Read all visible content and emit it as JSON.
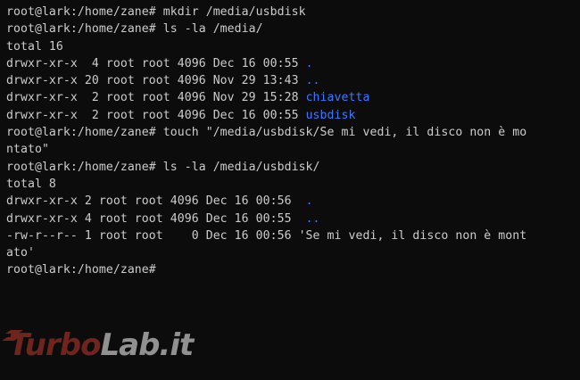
{
  "terminal": {
    "lines": [
      {
        "text": "root@lark:/home/zane# mkdir /media/usbdisk",
        "name": ""
      },
      {
        "text": "root@lark:/home/zane# ls -la /media/",
        "name": ""
      },
      {
        "text": "total 16",
        "name": ""
      },
      {
        "text": "drwxr-xr-x  4 root root 4096 Dec 16 00:55 ",
        "name": "."
      },
      {
        "text": "drwxr-xr-x 20 root root 4096 Nov 29 13:43 ",
        "name": ".."
      },
      {
        "text": "drwxr-xr-x  2 root root 4096 Nov 29 15:28 ",
        "name": "chiavetta"
      },
      {
        "text": "drwxr-xr-x  2 root root 4096 Dec 16 00:55 ",
        "name": "usbdisk"
      },
      {
        "text": "root@lark:/home/zane# touch \"/media/usbdisk/Se mi vedi, il disco non è mo",
        "name": ""
      },
      {
        "text": "ntato\"",
        "name": ""
      },
      {
        "text": "root@lark:/home/zane# ls -la /media/usbdisk/",
        "name": ""
      },
      {
        "text": "total 8",
        "name": ""
      },
      {
        "text": "drwxr-xr-x 2 root root 4096 Dec 16 00:56  ",
        "name": "."
      },
      {
        "text": "drwxr-xr-x 4 root root 4096 Dec 16 00:55  ",
        "name": ".."
      },
      {
        "text": "-rw-r--r-- 1 root root    0 Dec 16 00:56 'Se mi vedi, il disco non è mont",
        "name": ""
      },
      {
        "text": "ato'",
        "name": ""
      },
      {
        "text": "root@lark:/home/zane#",
        "name": ""
      }
    ]
  },
  "watermark": {
    "part1": "Turbo",
    "part2": "Lab.it",
    "color1": "#c0392b",
    "color2": "#ffffff"
  },
  "colors": {
    "background": "#0c0c0c",
    "foreground": "#cccccc",
    "directory": "#3b78ff"
  }
}
